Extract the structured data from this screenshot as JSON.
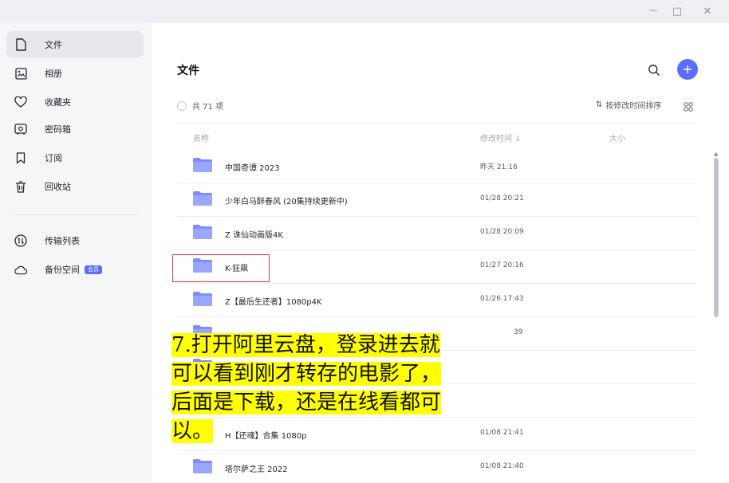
{
  "window": {
    "minimize": "－",
    "maximize": "□",
    "close": "✕"
  },
  "sidebar": {
    "items": [
      {
        "label": "文件",
        "icon": "file-icon"
      },
      {
        "label": "相册",
        "icon": "photo-album-icon"
      },
      {
        "label": "收藏夹",
        "icon": "heart-icon"
      },
      {
        "label": "密码箱",
        "icon": "safe-box-icon"
      },
      {
        "label": "订阅",
        "icon": "bookmark-icon"
      },
      {
        "label": "回收站",
        "icon": "trash-icon"
      }
    ],
    "bottom_items": [
      {
        "label": "传输列表",
        "icon": "transfer-icon"
      },
      {
        "label": "备份空间",
        "icon": "cloud-icon",
        "badge": "会员"
      }
    ]
  },
  "main": {
    "title": "文件",
    "count_text": "共 71 项",
    "sort_label": "按修改时间排序",
    "sort_icon": "⇅",
    "columns": {
      "name": "名称",
      "modified": "修改时间 ↓",
      "size": "大小"
    },
    "rows": [
      {
        "name": "中国奇谭 2023",
        "time": "昨天 21:16"
      },
      {
        "name": "少年白马醉春风 (20集持续更新中)",
        "time": "01/28 20:21"
      },
      {
        "name": "Z 诛仙动画版4K",
        "time": "01/28 20:09"
      },
      {
        "name": "K-狂飙",
        "time": "01/27 20:16"
      },
      {
        "name": "Z【最后生还者】1080p4K",
        "time": "01/26 17:43"
      },
      {
        "name": "",
        "time": "39"
      },
      {
        "name": "",
        "time": ""
      },
      {
        "name": "",
        "time": ""
      },
      {
        "name": "H【还魂】合集 1080p",
        "time": "01/08 21:41"
      },
      {
        "name": "塔尔萨之王 2022",
        "time": "01/08 21:40"
      }
    ]
  },
  "caption": {
    "lines": [
      "7.打开阿里云盘，登录进去就",
      "可以看到刚才转存的电影了，",
      "后面是下载，还是在线看都可",
      "以。"
    ]
  },
  "colors": {
    "accent": "#5b6cff",
    "highlight": "#ffff00",
    "annotation_border": "#e5393a"
  }
}
